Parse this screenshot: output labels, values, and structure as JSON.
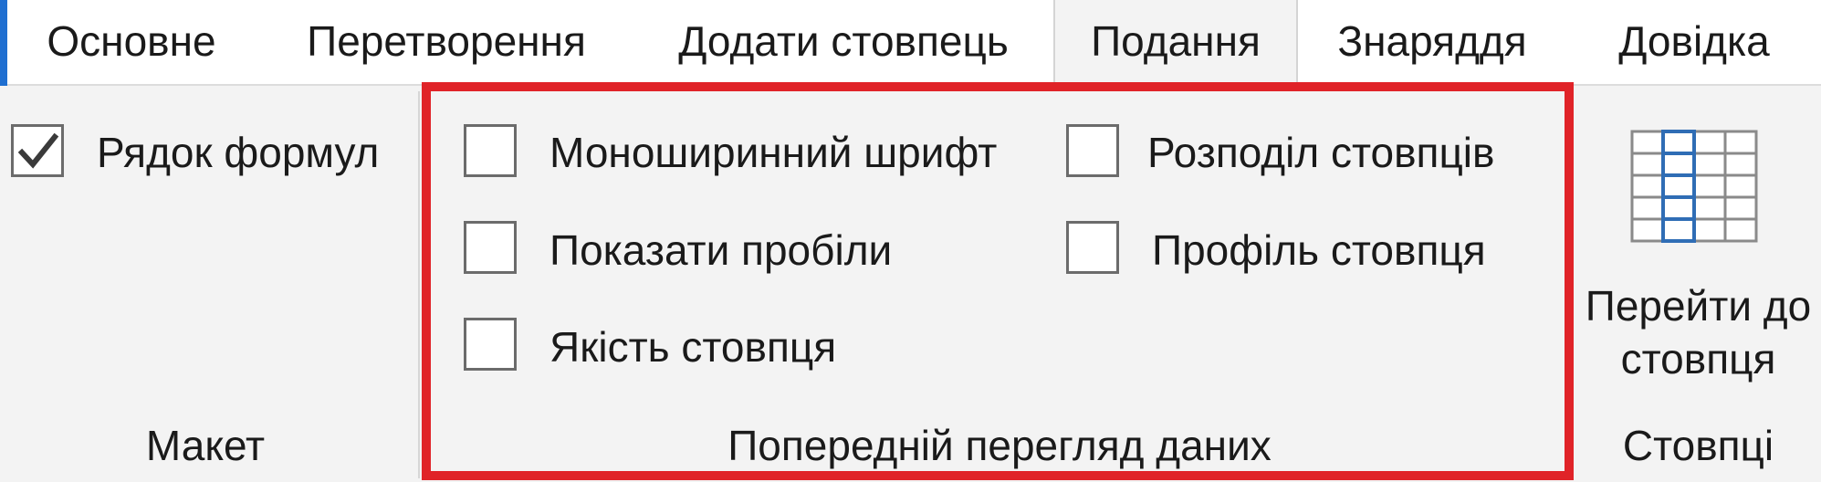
{
  "tabs": [
    {
      "label": "Основне"
    },
    {
      "label": "Перетворення"
    },
    {
      "label": "Додати стовпець"
    },
    {
      "label": "Подання"
    },
    {
      "label": "Знаряддя"
    },
    {
      "label": "Довідка"
    }
  ],
  "active_tab": "Подання",
  "layout_group": {
    "formula_bar_label": "Рядок формул",
    "formula_bar_checked": true,
    "group_label": "Макет"
  },
  "data_preview_group": {
    "monospaced_label": "Моноширинний шрифт",
    "show_whitespace_label": "Показати пробіли",
    "column_quality_label": "Якість стовпця",
    "column_distribution_label": "Розподіл стовпців",
    "column_profile_label": "Профіль стовпця",
    "group_label": "Попередній перегляд даних"
  },
  "columns_group": {
    "goto_line1": "Перейти до",
    "goto_line2": "стовпця",
    "group_label": "Стовпці"
  },
  "colors": {
    "accent": "#1f6fd1",
    "highlight": "#e02328",
    "icon_blue": "#2f6db5"
  }
}
